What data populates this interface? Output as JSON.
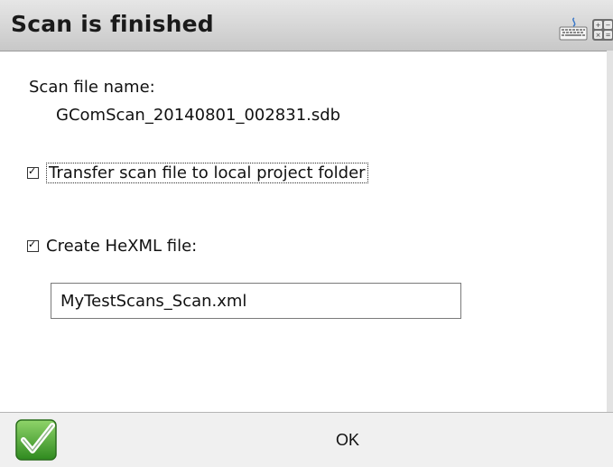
{
  "window": {
    "title": "Scan is finished",
    "icons": [
      "keyboard-icon",
      "calculator-icon"
    ]
  },
  "scan": {
    "file_label": "Scan file name:",
    "file_name": "GComScan_20140801_002831.sdb"
  },
  "options": {
    "transfer": {
      "label": "Transfer scan file to local project folder",
      "checked": true
    },
    "hexml": {
      "label": "Create HeXML file:",
      "checked": true,
      "value": "MyTestScans_Scan.xml"
    }
  },
  "footer": {
    "ok_label": "OK",
    "ok_icon": "green-checkmark-icon"
  },
  "colors": {
    "titlebar": "#d6d6d6",
    "accent_green": "#3a9a2a"
  }
}
